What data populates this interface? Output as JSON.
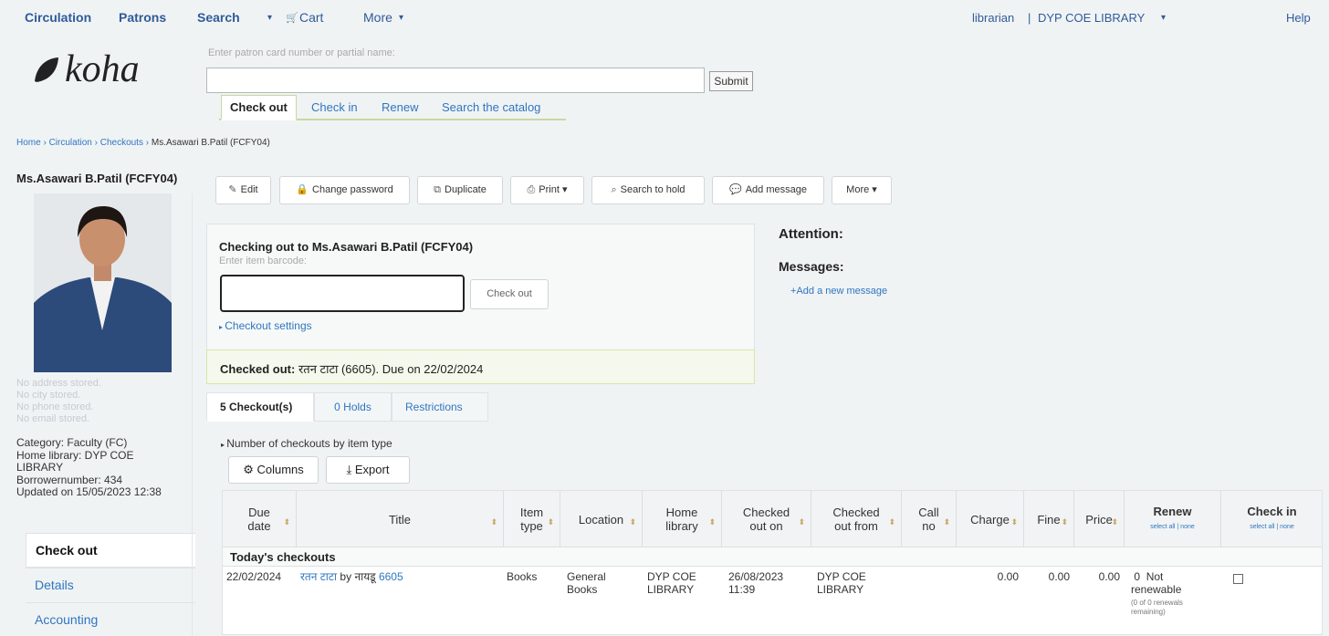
{
  "topnav": {
    "circulation": "Circulation",
    "patrons": "Patrons",
    "search": "Search",
    "cart": "Cart",
    "more": "More",
    "user": "librarian",
    "separator": "|",
    "library": "DYP COE LIBRARY",
    "help": "Help"
  },
  "logo": {
    "text": "koha"
  },
  "patron_search": {
    "hint": "Enter patron card number or partial name:",
    "value": "",
    "submit": "Submit"
  },
  "search_tabs": [
    "Check out",
    "Check in",
    "Renew",
    "Search the catalog"
  ],
  "breadcrumb": [
    "Home",
    "Circulation",
    "Checkouts",
    "Ms.Asawari B.Patil (FCFY04)"
  ],
  "patron": {
    "name": "Ms.Asawari B.Patil (FCFY04)",
    "faded_lines": [
      "No address stored.",
      "No city stored.",
      "No phone stored.",
      "No email stored."
    ],
    "category": "Category: Faculty (FC)",
    "home_library_label": "Home library: DYP COE",
    "home_library_cont": "LIBRARY",
    "borrowernumber": "Borrowernumber: 434",
    "updated": "Updated on 15/05/2023 12:38"
  },
  "side_menu": [
    "Check out",
    "Details",
    "Accounting"
  ],
  "toolbar": {
    "edit": "Edit",
    "change_password": "Change password",
    "duplicate": "Duplicate",
    "print": "Print",
    "search_to_hold": "Search to hold",
    "add_message": "Add message",
    "more": "More"
  },
  "checkout": {
    "title": "Checking out to Ms.Asawari B.Patil (FCFY04)",
    "hint": "Enter item barcode:",
    "barcode_value": "",
    "button": "Check out",
    "settings": "Checkout settings",
    "msg_label": "Checked out:",
    "msg_text": "रतन टाटा (6605). Due on 22/02/2024"
  },
  "attention": {
    "attention_label": "Attention:",
    "messages_label": "Messages:",
    "add_message": "Add a new message"
  },
  "patron_tabs": [
    "5 Checkout(s)",
    "0 Holds",
    "Restrictions"
  ],
  "num_by_type": "Number of checkouts by item type",
  "table_buttons": {
    "columns": "Columns",
    "export": "Export"
  },
  "table": {
    "headers": {
      "due_date": [
        "Due",
        "date"
      ],
      "title": "Title",
      "item_type": [
        "Item",
        "type"
      ],
      "location": "Location",
      "home_library": [
        "Home",
        "library"
      ],
      "checked_out_on": [
        "Checked",
        "out on"
      ],
      "checked_out_from": [
        "Checked",
        "out from"
      ],
      "call_no": [
        "Call",
        "no"
      ],
      "charge": "Charge",
      "fine": "Fine",
      "price": "Price",
      "renew": "Renew",
      "renew_select": "select all | none",
      "check_in": "Check in",
      "check_in_select": "select all | none"
    },
    "group": "Today's checkouts",
    "row": {
      "due_date": "22/02/2024",
      "title": "रतन टाटा",
      "by": "by",
      "author": "नायडू",
      "barcode": "6605",
      "item_type": "Books",
      "location": [
        "General",
        "Books"
      ],
      "home_library": [
        "DYP COE",
        "LIBRARY"
      ],
      "checked_out_on": [
        "26/08/2023",
        "11:39"
      ],
      "checked_out_from": [
        "DYP COE",
        "LIBRARY"
      ],
      "call_no": "",
      "charge": "0.00",
      "fine": "0.00",
      "price": "0.00",
      "renew_count": "0",
      "renew_status_1": "Not",
      "renew_status_2": "renewable",
      "renew_note_1": "(0 of 0 renewals",
      "renew_note_2": "remaining)"
    }
  },
  "colors": {
    "link": "#2f76c0",
    "nav": "#2f5b9a",
    "accent": "#c9d8a2",
    "bg": "#f0f3f4"
  }
}
